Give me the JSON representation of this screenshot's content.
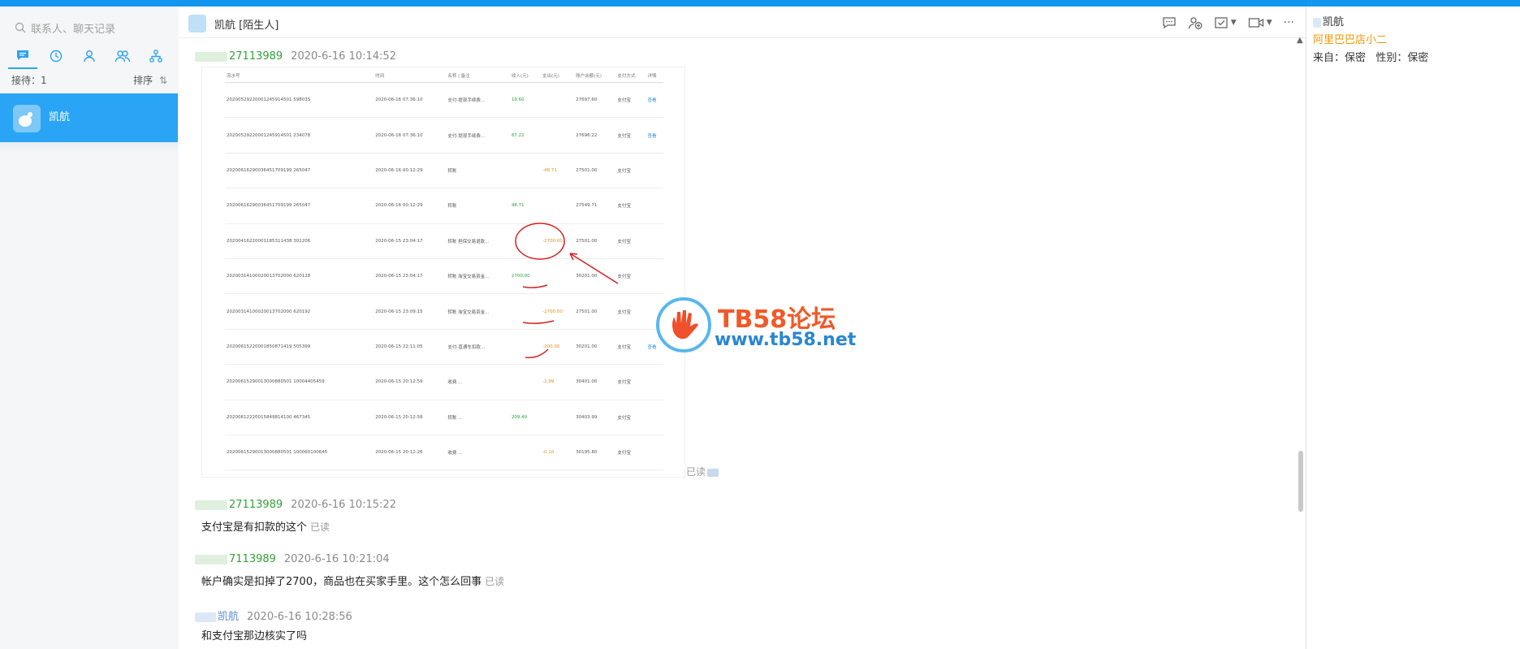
{
  "search": {
    "placeholder": "联系人、聊天记录"
  },
  "sidebar": {
    "reception_label": "接待：1",
    "sort_label": "排序",
    "contact_name": "凯航"
  },
  "header": {
    "contact_name": "凯航",
    "tag": "[陌生人]"
  },
  "messages": [
    {
      "sender": "27113989",
      "time": "2020-6-16 10:14:52",
      "type": "image",
      "read": "已读"
    },
    {
      "sender": "27113989",
      "time": "2020-6-16 10:15:22",
      "text": "支付宝是有扣款的这个",
      "read": "已读"
    },
    {
      "sender": "7113989",
      "time": "2020-6-16 10:21:04",
      "text": "帐户确实是扣掉了2700，商品也在买家手里。这个怎么回事",
      "read": "已读"
    },
    {
      "sender": "凯航",
      "time": "2020-6-16 10:28:56",
      "text": "和支付宝那边核实了吗"
    }
  ],
  "shot_table": {
    "headers": [
      "流水号",
      "时间",
      "名称 | 备注",
      "收入(元)",
      "支出(元)",
      "账户余额(元)",
      "支付方式",
      "详情"
    ],
    "rows": [
      [
        "20200529220001245914501 59803S",
        "2020-06-16 07:36:10",
        "支付-提现手续费...",
        "19.60",
        "",
        "27697.60",
        "支付宝",
        "查看"
      ],
      [
        "20200529220001245914501 234078",
        "2020-06-16 07:36:10",
        "支付-提现手续费...",
        "67.22",
        "",
        "27696.22",
        "支付宝",
        "查看"
      ],
      [
        "20200616290036451709199 265047",
        "2020-06-16 00:12:29",
        "转账",
        "",
        "-48.71",
        "27501.00",
        "支付宝",
        ""
      ],
      [
        "20200616290036451709199 265047",
        "2020-06-16 00:12:29",
        "转账",
        "48.71",
        "",
        "27549.71",
        "支付宝",
        ""
      ],
      [
        "20200416220001185311438 301206",
        "2020-06-15 23:04:17",
        "转账 担保交易退款...",
        "",
        "-2700.00",
        "27501.00",
        "支付宝",
        ""
      ],
      [
        "20200314100020013702000 620128",
        "2020-06-15 23:04:17",
        "转账 淘宝交易资金...",
        "2700.00",
        "",
        "30201.00",
        "支付宝",
        ""
      ],
      [
        "20200314100020013702000 620192",
        "2020-06-15 23:09:15",
        "转账 淘宝交易资金...",
        "",
        "-2700.00",
        "27501.00",
        "支付宝",
        ""
      ],
      [
        "20200615220001850871419 505399",
        "2020-06-15 22:11:05",
        "支付-直通车扣款...",
        "",
        "-200.00",
        "30201.00",
        "支付宝",
        "查看"
      ],
      [
        "20200615290013000880501 10004405459",
        "2020-06-15 20:12:59",
        "收费 ...",
        "",
        "-2.99",
        "30401.00",
        "支付宝",
        ""
      ],
      [
        "20200612220015849814100 467345",
        "2020-06-15 20:12:56",
        "转账 ...",
        "209.49",
        "",
        "30403.99",
        "支付宝",
        ""
      ],
      [
        "20200615290013000880501 100060100645",
        "2020-06-15 20:12:26",
        "收费 ...",
        "",
        "-0.10",
        "30195.80",
        "支付宝",
        ""
      ]
    ]
  },
  "watermark": {
    "title": "TB58论坛",
    "url": "www.tb58.net"
  },
  "profile": {
    "name": "凯航",
    "shop": "阿里巴巴店小二",
    "info": "来自：保密   性别：保密"
  },
  "colors": {
    "accent": "#2aa4f4",
    "topbar": "#1296f0",
    "sender_green": "#33a136",
    "shop_orange": "#f39800"
  }
}
